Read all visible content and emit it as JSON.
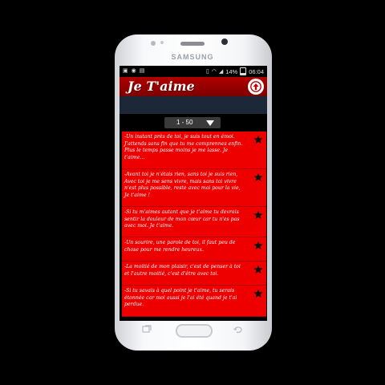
{
  "device": {
    "brand": "SAMSUNG"
  },
  "statusbar": {
    "battery": "14%",
    "time": "06:04"
  },
  "app": {
    "title": "Je T'aime"
  },
  "pager": {
    "range": "1 - 50"
  },
  "quotes": [
    "-Un instant près de toi, je suis tout en émoi. J'attends sans fin que tu me comprennes enfin. Plus le temps passe moins je me lasse. Je t'aime...",
    "-Avant toi je n'étais rien, sans toi je suis rien, Avec toi je me sens vivre, mais sans toi vivre n'est plus possible, reste avec moi pour la vie, Je t'aime !",
    "-Si tu m'aimes autant que je t'aime tu devrais sentir la douleur de mon cœur car tu n'es pas avec moi. Je t'aime.",
    "-Un sourire, une parole de toi, il faut peu de chose pour me rendre heureux.",
    "-La moitié de mon plaisir, c'est de penser à toi et l'autre moitié, c'est d'être avec toi.",
    "-Si tu savais à quel point je t'aime, tu serais étonnée car moi aussi je l'ai été quand je t'ai perdue."
  ]
}
